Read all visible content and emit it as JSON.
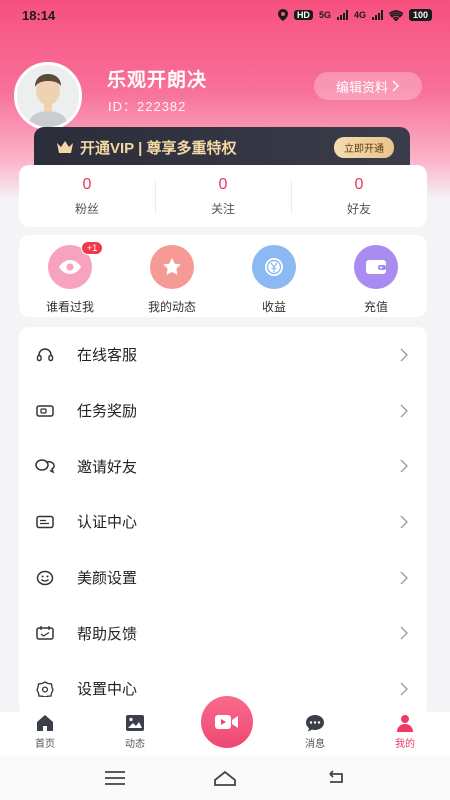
{
  "status_bar": {
    "time": "18:14",
    "hd": "HD",
    "net1": "5G",
    "net2": "4G",
    "battery": "100"
  },
  "profile": {
    "name": "乐观开朗决",
    "id": "ID：222382",
    "edit_label": "编辑资料"
  },
  "vip": {
    "text": "开通VIP | 尊享多重特权",
    "button": "立即开通"
  },
  "stats": [
    {
      "value": "0",
      "label": "粉丝"
    },
    {
      "value": "0",
      "label": "关注"
    },
    {
      "value": "0",
      "label": "好友"
    }
  ],
  "quick": [
    {
      "label": "谁看过我",
      "icon": "eye-icon",
      "badge": "+1",
      "color": "#f7a3c0"
    },
    {
      "label": "我的动态",
      "icon": "star-icon",
      "color": "#f59a95"
    },
    {
      "label": "收益",
      "icon": "coin-icon",
      "color": "#8db9f2"
    },
    {
      "label": "充值",
      "icon": "wallet-icon",
      "color": "#a98cf0"
    }
  ],
  "menu": [
    {
      "label": "在线客服",
      "icon": "headset-icon"
    },
    {
      "label": "任务奖励",
      "icon": "ticket-icon"
    },
    {
      "label": "邀请好友",
      "icon": "chat-bubbles-icon"
    },
    {
      "label": "认证中心",
      "icon": "id-card-icon"
    },
    {
      "label": "美颜设置",
      "icon": "smile-icon"
    },
    {
      "label": "帮助反馈",
      "icon": "feedback-icon"
    },
    {
      "label": "设置中心",
      "icon": "settings-icon"
    }
  ],
  "tabs": [
    {
      "label": "首页",
      "icon": "home-icon",
      "active": false
    },
    {
      "label": "动态",
      "icon": "image-icon",
      "active": false
    },
    {
      "label": "",
      "icon": "video-camera-icon",
      "active": false
    },
    {
      "label": "消息",
      "icon": "message-icon",
      "active": false
    },
    {
      "label": "我的",
      "icon": "person-icon",
      "active": true
    }
  ],
  "colors": {
    "accent": "#ec3a65",
    "vip_gold": "#f3d7a4",
    "vip_bg": "#2c2d3a"
  }
}
